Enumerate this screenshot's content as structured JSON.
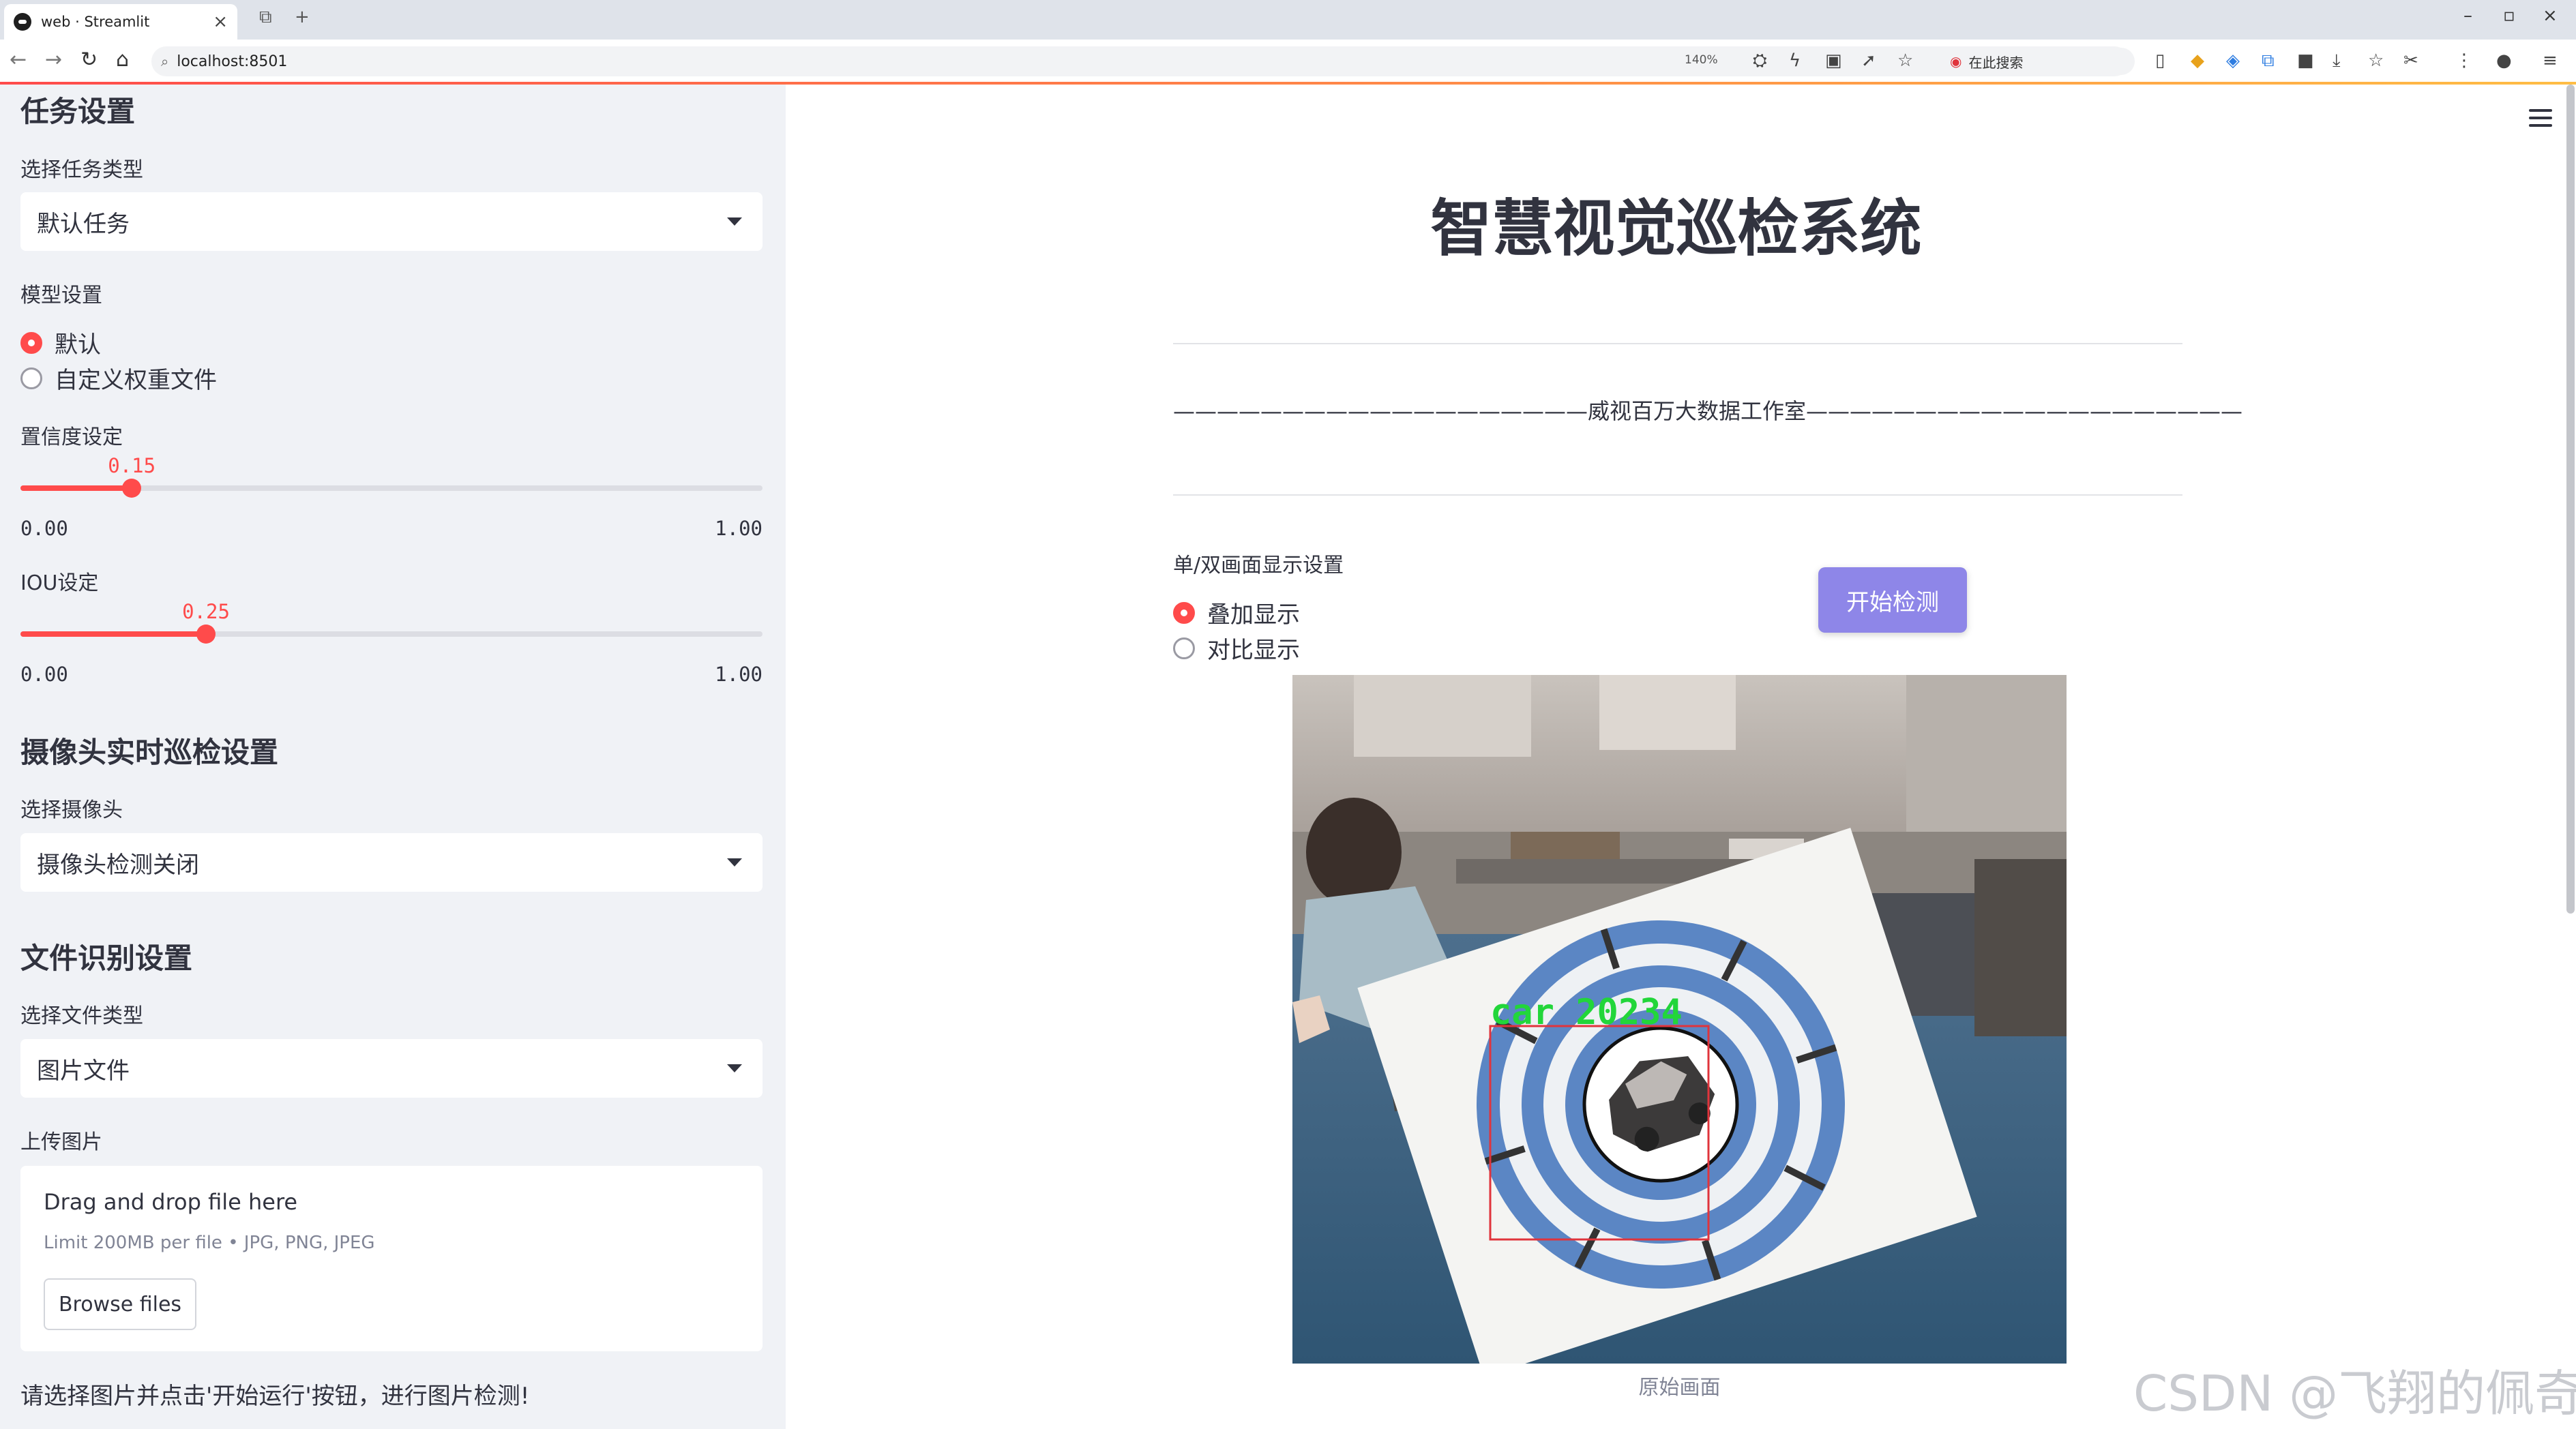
{
  "browser": {
    "tab_title": "web · Streamlit",
    "url": "localhost:8501",
    "zoom": "140%",
    "search_placeholder": "在此搜索"
  },
  "sidebar": {
    "task_section": "任务设置",
    "task_type_label": "选择任务类型",
    "task_type_value": "默认任务",
    "model_label": "模型设置",
    "model_options": [
      "默认",
      "自定义权重文件"
    ],
    "model_selected": "默认",
    "conf_label": "置信度设定",
    "conf": {
      "value": 0.15,
      "display": "0.15",
      "min": "0.00",
      "max": "1.00"
    },
    "iou_label": "IOU设定",
    "iou": {
      "value": 0.25,
      "display": "0.25",
      "min": "0.00",
      "max": "1.00"
    },
    "camera_section": "摄像头实时巡检设置",
    "camera_label": "选择摄像头",
    "camera_value": "摄像头检测关闭",
    "file_section": "文件识别设置",
    "file_type_label": "选择文件类型",
    "file_type_value": "图片文件",
    "upload_label": "上传图片",
    "upload_title": "Drag and drop file here",
    "upload_limit": "Limit 200MB per file • JPG, PNG, JPEG",
    "browse_label": "Browse files",
    "hint": "请选择图片并点击'开始运行'按钮，进行图片检测!"
  },
  "main": {
    "title": "智慧视觉巡检系统",
    "studio_line": "———————————————————威视百万大数据工作室————————————————————",
    "display_label": "单/双画面显示设置",
    "display_options": [
      "叠加显示",
      "对比显示"
    ],
    "display_selected": "叠加显示",
    "start_button": "开始检测",
    "detection_label": "car 20234",
    "image_caption": "原始画面",
    "watermark": "CSDN @飞翔的佩奇"
  },
  "colors": {
    "accent": "#ff4b4b",
    "button": "#8e86e8",
    "sidebar_bg": "#f0f2f6",
    "detection_box": "#e0343c",
    "detection_text": "#22d63a"
  }
}
